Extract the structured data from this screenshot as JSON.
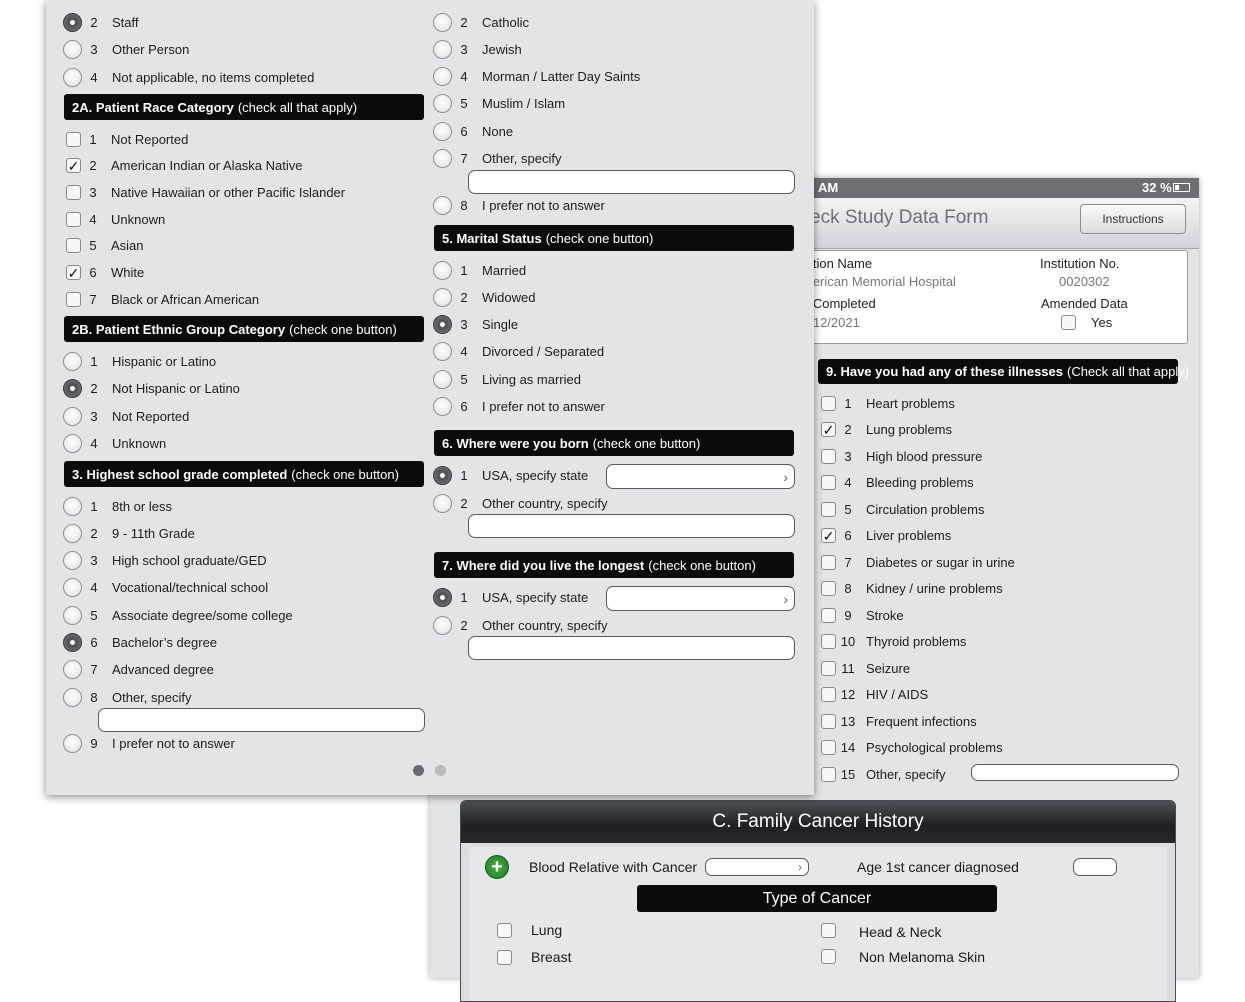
{
  "back": {
    "status_time": "AM",
    "battery": "32 %",
    "title": "eck Study Data Form",
    "instructions_button": "Instructions",
    "info": {
      "institution_name_label": "tution Name",
      "institution_name_value": "merican Memorial Hospital",
      "institution_no_label": "Institution No.",
      "institution_no_value": "0020302",
      "date_label": "e Completed",
      "date_value": "2/12/2021",
      "amended_label": "Amended Data",
      "amended_yes": "Yes"
    },
    "q9": {
      "title": "9. Have you had any of these illnesses",
      "hint": "(Check all that apply)",
      "items": [
        {
          "num": "1",
          "label": "Heart problems",
          "mark": ""
        },
        {
          "num": "2",
          "label": "Lung problems",
          "mark": "✓"
        },
        {
          "num": "3",
          "label": "High blood pressure",
          "mark": ""
        },
        {
          "num": "4",
          "label": "Bleeding problems",
          "mark": ""
        },
        {
          "num": "5",
          "label": "Circulation problems",
          "mark": ""
        },
        {
          "num": "6",
          "label": "Liver problems",
          "mark": "✓"
        },
        {
          "num": "7",
          "label": "Diabetes or sugar in urine",
          "mark": ""
        },
        {
          "num": "8",
          "label": "Kidney / urine problems",
          "mark": ""
        },
        {
          "num": "9",
          "label": "Stroke",
          "mark": ""
        },
        {
          "num": "10",
          "label": "Thyroid problems",
          "mark": ""
        },
        {
          "num": "11",
          "label": "Seizure",
          "mark": ""
        },
        {
          "num": "12",
          "label": "HIV / AIDS",
          "mark": ""
        },
        {
          "num": "13",
          "label": "Frequent infections",
          "mark": ""
        },
        {
          "num": "14",
          "label": "Psychological problems",
          "mark": ""
        },
        {
          "num": "15",
          "label": "Other, specify",
          "mark": ""
        }
      ]
    },
    "family": {
      "title": "C. Family Cancer History",
      "relative_label": "Blood Relative with Cancer",
      "age_label": "Age 1st cancer diagnosed",
      "type_title": "Type of Cancer",
      "types": [
        "Lung",
        "Breast",
        "Head & Neck",
        "Non Melanoma Skin"
      ]
    }
  },
  "front": {
    "top_items": [
      {
        "num": "2",
        "label": "Staff",
        "selected": true
      },
      {
        "num": "3",
        "label": "Other Person",
        "selected": false
      },
      {
        "num": "4",
        "label": "Not applicable, no items completed",
        "selected": false
      }
    ],
    "q2a": {
      "title": "2A. Patient Race Category",
      "hint": "(check all that apply)",
      "items": [
        {
          "num": "1",
          "label": "Not Reported",
          "mark": ""
        },
        {
          "num": "2",
          "label": "American Indian or Alaska Native",
          "mark": "✓"
        },
        {
          "num": "3",
          "label": "Native Hawaiian or other Pacific Islander",
          "mark": ""
        },
        {
          "num": "4",
          "label": "Unknown",
          "mark": ""
        },
        {
          "num": "5",
          "label": "Asian",
          "mark": ""
        },
        {
          "num": "6",
          "label": "White",
          "mark": "✓"
        },
        {
          "num": "7",
          "label": "Black or African American",
          "mark": ""
        }
      ]
    },
    "q2b": {
      "title": "2B. Patient Ethnic Group Category",
      "hint": "(check one button)",
      "items": [
        {
          "num": "1",
          "label": "Hispanic or Latino",
          "selected": false
        },
        {
          "num": "2",
          "label": "Not Hispanic or Latino",
          "selected": true
        },
        {
          "num": "3",
          "label": "Not Reported",
          "selected": false
        },
        {
          "num": "4",
          "label": "Unknown",
          "selected": false
        }
      ]
    },
    "q3": {
      "title": "3. Highest school grade completed",
      "hint": "(check one button)",
      "items": [
        {
          "num": "1",
          "label": "8th or less",
          "selected": false
        },
        {
          "num": "2",
          "label": "9 - 11th Grade",
          "selected": false
        },
        {
          "num": "3",
          "label": "High school graduate/GED",
          "selected": false
        },
        {
          "num": "4",
          "label": "Vocational/technical school",
          "selected": false
        },
        {
          "num": "5",
          "label": "Associate degree/some college",
          "selected": false
        },
        {
          "num": "6",
          "label": "Bachelor’s degree",
          "selected": true
        },
        {
          "num": "7",
          "label": "Advanced degree",
          "selected": false
        },
        {
          "num": "8",
          "label": "Other, specify",
          "selected": false
        }
      ],
      "last": {
        "num": "9",
        "label": "I prefer not to answer",
        "selected": false
      }
    },
    "q4": {
      "items": [
        {
          "num": "2",
          "label": "Catholic",
          "selected": false
        },
        {
          "num": "3",
          "label": "Jewish",
          "selected": false
        },
        {
          "num": "4",
          "label": "Morman / Latter Day Saints",
          "selected": false
        },
        {
          "num": "5",
          "label": "Muslim / Islam",
          "selected": false
        },
        {
          "num": "6",
          "label": "None",
          "selected": false
        },
        {
          "num": "7",
          "label": "Other, specify",
          "selected": false
        }
      ],
      "last": {
        "num": "8",
        "label": "I prefer not to answer",
        "selected": false
      }
    },
    "q5": {
      "title": "5. Marital Status",
      "hint": "(check one button)",
      "items": [
        {
          "num": "1",
          "label": "Married",
          "selected": false
        },
        {
          "num": "2",
          "label": "Widowed",
          "selected": false
        },
        {
          "num": "3",
          "label": "Single",
          "selected": true
        },
        {
          "num": "4",
          "label": "Divorced / Separated",
          "selected": false
        },
        {
          "num": "5",
          "label": "Living as married",
          "selected": false
        },
        {
          "num": "6",
          "label": "I prefer not to answer",
          "selected": false
        }
      ]
    },
    "q6": {
      "title": "6. Where were you born",
      "hint": "(check one button)",
      "opt1": {
        "num": "1",
        "label": "USA, specify state",
        "selected": true
      },
      "opt2": {
        "num": "2",
        "label": "Other country, specify",
        "selected": false
      }
    },
    "q7": {
      "title": "7. Where did you live the longest",
      "hint": "(check one button)",
      "opt1": {
        "num": "1",
        "label": "USA, specify state",
        "selected": true
      },
      "opt2": {
        "num": "2",
        "label": "Other country, specify",
        "selected": false
      }
    },
    "page_dots": {
      "count": 2,
      "active": 1
    }
  }
}
